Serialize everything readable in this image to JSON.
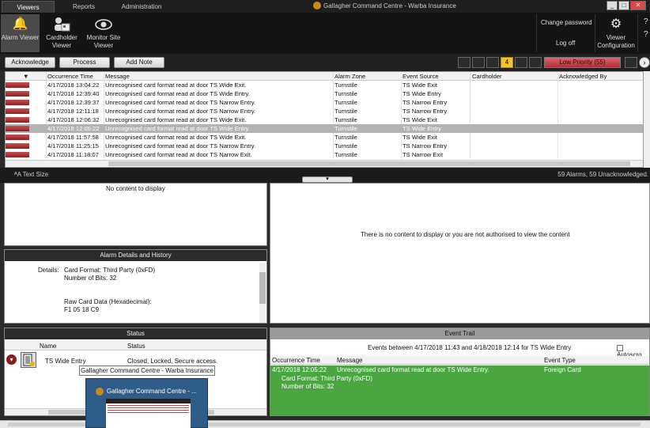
{
  "menu": {
    "tabs": [
      "Viewers",
      "Reports",
      "Administration"
    ],
    "active": "Viewers"
  },
  "window": {
    "title": "Gallagher Command Centre - Warba Insurance",
    "controls": [
      "_",
      "□",
      "✕"
    ]
  },
  "ribbon": {
    "buttons": [
      {
        "label": "Alarm Viewer",
        "icon": "bell-icon"
      },
      {
        "label": "Cardholder Viewer",
        "icon": "cardholder-icon"
      },
      {
        "label": "Monitor Site Viewer",
        "icon": "eye-icon"
      }
    ],
    "change_password": "Change password",
    "log_off": "Log off",
    "viewer_config": "Viewer Configuration",
    "help": "?",
    "help2": "?"
  },
  "toolbar": {
    "acknowledge": "Acknowledge",
    "process": "Process",
    "add_note": "Add Note",
    "page_current": "4",
    "priority": "Low Priority (55)"
  },
  "alarms": {
    "columns": [
      "Occurrence Time",
      "Message",
      "Alarm Zone",
      "Event Source",
      "Cardholder",
      "Acknowledged By"
    ],
    "rows": [
      [
        "4/17/2018 13:04:22",
        "Unrecognised card format read at door TS Wide Exit.",
        "Turnstile",
        "TS Wide Exit",
        "",
        ""
      ],
      [
        "4/17/2018 12:39:40",
        "Unrecognised card format read at door TS Wide Entry.",
        "Turnstile",
        "TS Wide Entry",
        "",
        ""
      ],
      [
        "4/17/2018 12:39:37",
        "Unrecognised card format read at door TS Narrow Entry.",
        "Turnstile",
        "TS Narrow Entry",
        "",
        ""
      ],
      [
        "4/17/2018 12:11:18",
        "Unrecognised card format read at door TS Narrow Entry.",
        "Turnstile",
        "TS Narrow Entry",
        "",
        ""
      ],
      [
        "4/17/2018 12:06:32",
        "Unrecognised card format read at door TS Wide Exit.",
        "Turnstile",
        "TS Wide Exit",
        "",
        ""
      ],
      [
        "4/17/2018 12:05:22",
        "Unrecognised card format read at door TS Wide Entry.",
        "Turnstile",
        "TS Wide Entry",
        "",
        ""
      ],
      [
        "4/17/2018 11:57:58",
        "Unrecognised card format read at door TS Wide Exit.",
        "Turnstile",
        "TS Wide Exit",
        "",
        ""
      ],
      [
        "4/17/2018 11:25:15",
        "Unrecognised card format read at door TS Narrow Entry.",
        "Turnstile",
        "TS Narrow Entry",
        "",
        ""
      ],
      [
        "4/17/2018 11:18:07",
        "Unrecognised card format read at door TS Narrow Exit.",
        "Turnstile",
        "TS Narrow Exit",
        "",
        ""
      ]
    ],
    "selected_index": 5,
    "priority_color": "#a52a2a"
  },
  "status_strip": {
    "text_size": "Text Size",
    "summary": "59 Alarms, 59 Unacknowledged."
  },
  "left_top": {
    "empty": "No content to display"
  },
  "right_top": {
    "empty": "There is no content to display or you are not authorised to view the content"
  },
  "details": {
    "title": "Alarm Details and History",
    "label": "Details:",
    "lines": [
      "Card Format: Third Party (0xFD)",
      "Number of Bits: 32",
      "",
      "",
      "Raw Card Data (Hexadecimal):",
      "F1 05 18 C9"
    ]
  },
  "status": {
    "title": "Status",
    "col_name": "Name",
    "col_status": "Status",
    "name": "TS Wide Entry",
    "value": "Closed, Locked, Secure access."
  },
  "event_trail": {
    "title": "Event Trail",
    "subtitle": "Events between 4/17/2018 11:43 and 4/18/2018 12:14 for TS Wide Entry",
    "autoscroll": "Autoscro",
    "columns": [
      "Occurrence Time",
      "Message",
      "Event Type"
    ],
    "row": {
      "time": "4/17/2018 12:05:22",
      "message": "Unrecognised card format read at door TS Wide Entry.",
      "type": "Foreign Card"
    },
    "detail_lines": [
      "Card Format: Third Party (0xFD)",
      "Number of Bits: 32"
    ]
  },
  "taskbar": {
    "tooltip": "Gallagher Command Centre - Warba Insurance",
    "thumb_title": "Gallagher Command Centre - ..."
  }
}
